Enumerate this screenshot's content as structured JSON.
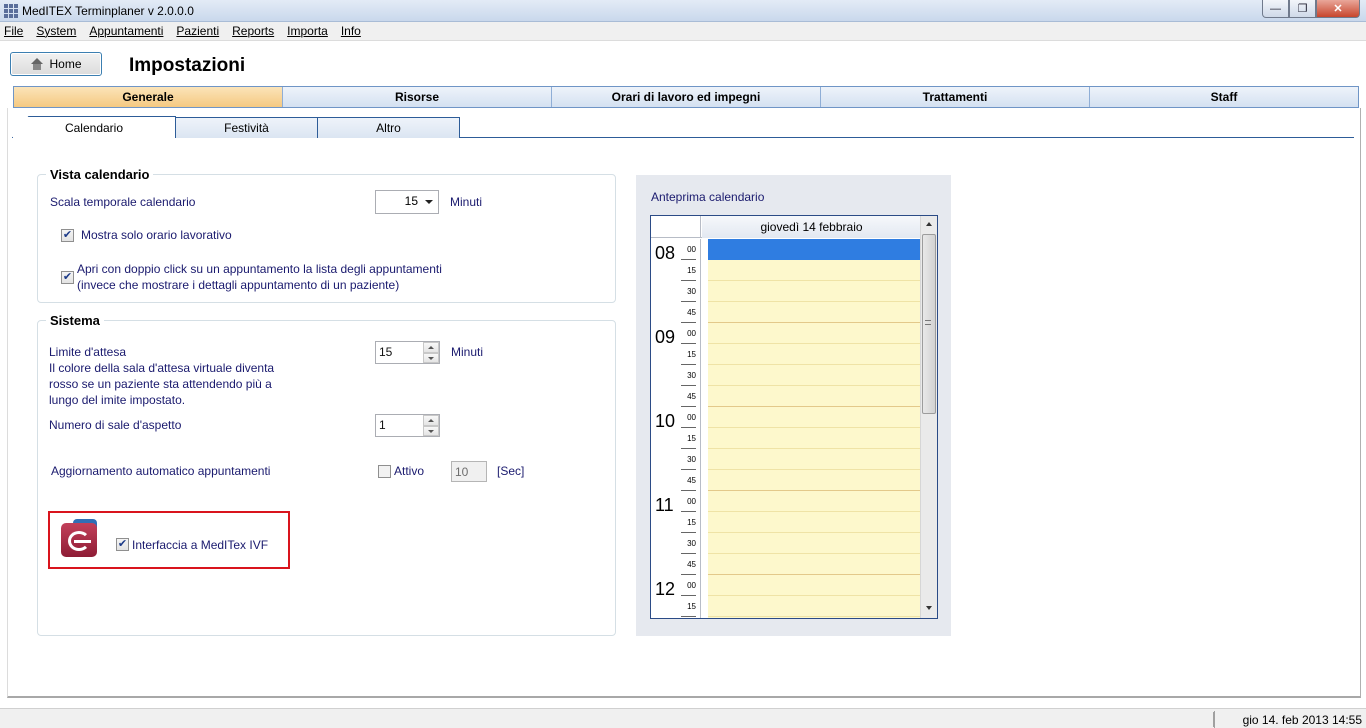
{
  "window": {
    "title": "MedITEX  Terminplaner v 2.0.0.0"
  },
  "menu": [
    "File",
    "System",
    "Appuntamenti",
    "Pazienti",
    "Reports",
    "Importa",
    "Info"
  ],
  "header": {
    "home_label": "Home",
    "page_title": "Impostazioni"
  },
  "main_tabs": [
    "Generale",
    "Risorse",
    "Orari di lavoro ed impegni",
    "Trattamenti",
    "Staff"
  ],
  "sub_tabs": [
    "Calendario",
    "Festività",
    "Altro"
  ],
  "vista": {
    "title": "Vista calendario",
    "scala_label": "Scala temporale calendario",
    "scala_value": "15",
    "scala_unit": "Minuti",
    "solo_orario_label": "Mostra solo orario lavorativo",
    "solo_orario_checked": true,
    "doppio_click_line1": "Apri con doppio click su un appuntamento la lista degli appuntamenti",
    "doppio_click_line2": "(invece che mostrare i dettagli appuntamento di un paziente)",
    "doppio_click_checked": true
  },
  "sistema": {
    "title": "Sistema",
    "limite_label": "Limite d'attesa",
    "limite_desc1": "Il colore della sala d'attesa virtuale diventa",
    "limite_desc2": "rosso se un paziente sta attendendo più a",
    "limite_desc3": "lungo del imite impostato.",
    "limite_value": "15",
    "limite_unit": "Minuti",
    "sale_label": "Numero di sale d'aspetto",
    "sale_value": "1",
    "aggiornamento_label": "Aggiornamento automatico appuntamenti",
    "attivo_label": "Attivo",
    "attivo_checked": false,
    "sec_value": "10",
    "sec_unit": "[Sec]",
    "ivf_label": "Interfaccia a MedITex IVF",
    "ivf_checked": true
  },
  "preview": {
    "title": "Anteprima calendario",
    "day_header": "giovedì 14 febbraio",
    "hours": [
      "08",
      "09",
      "10",
      "11",
      "12"
    ],
    "quarters": [
      "00",
      "15",
      "30",
      "45"
    ]
  },
  "status": {
    "datetime": "gio 14. feb 2013 14:55"
  },
  "colors": {
    "active_tab": "#f5c981",
    "selected_slot": "#2f7de1",
    "slot_bg": "#fdf8cc",
    "highlight_border": "#d9141d"
  }
}
